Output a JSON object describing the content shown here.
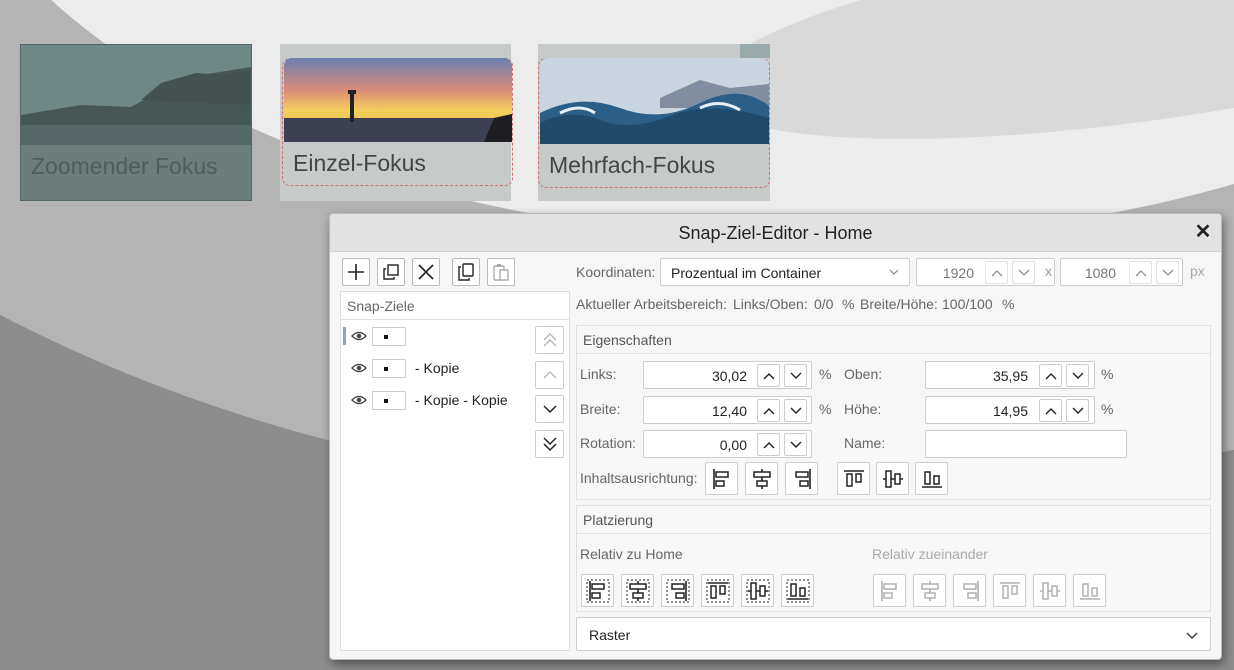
{
  "thumbnails": [
    {
      "caption": "Zoomender Fokus"
    },
    {
      "caption": "Einzel-Fokus"
    },
    {
      "caption": "Mehrfach-Fokus"
    }
  ],
  "dialog": {
    "title": "Snap-Ziel-Editor - Home",
    "close_label": "✕",
    "toolbar": [
      "plus-icon",
      "duplicate-icon",
      "delete-icon",
      "copy-icon",
      "paste-icon"
    ],
    "targets_header": "Snap-Ziele",
    "targets": [
      {
        "label": "",
        "selected": true
      },
      {
        "label": "- Kopie",
        "selected": false
      },
      {
        "label": "- Kopie - Kopie",
        "selected": false
      }
    ],
    "move_buttons": [
      "move-top-icon",
      "move-up-icon",
      "move-down-icon",
      "move-bottom-icon"
    ]
  },
  "coords": {
    "label": "Koordinaten:",
    "mode": "Prozentual im Container",
    "width": "1920",
    "x_sep": "x",
    "height": "1080",
    "unit": "px",
    "workspace_label": "Aktueller Arbeitsbereich:",
    "workspace_lt_label": "Links/Oben:",
    "workspace_lt_value": "0/0",
    "workspace_lt_unit": "%",
    "workspace_wh_label": "Breite/Höhe:",
    "workspace_wh_value": "100/100",
    "workspace_wh_unit": "%"
  },
  "properties": {
    "header": "Eigenschaften",
    "links_label": "Links:",
    "links_value": "30,02",
    "links_unit": "%",
    "oben_label": "Oben:",
    "oben_value": "35,95",
    "oben_unit": "%",
    "breite_label": "Breite:",
    "breite_value": "12,40",
    "breite_unit": "%",
    "hoehe_label": "Höhe:",
    "hoehe_value": "14,95",
    "hoehe_unit": "%",
    "rotation_label": "Rotation:",
    "rotation_value": "0,00",
    "name_label": "Name:",
    "name_value": "",
    "alignment_label": "Inhaltsausrichtung:"
  },
  "placement": {
    "header": "Platzierung",
    "relative_home": "Relativ zu Home",
    "relative_each": "Relativ zueinander"
  },
  "raster": {
    "label": "Raster"
  },
  "colors": {
    "accent": "#8fa4b5",
    "dialog_bg": "#f6f6f6",
    "title_bg": "#e2e2e2"
  }
}
